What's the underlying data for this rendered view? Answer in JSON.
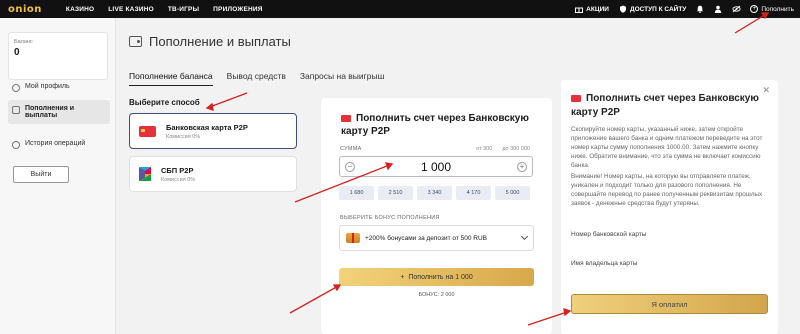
{
  "topbar": {
    "logo": "onion",
    "nav": [
      "КАЗИНО",
      "LIVE КАЗИНО",
      "ТВ-ИГРЫ",
      "ПРИЛОЖЕНИЯ"
    ],
    "promo": "АКЦИИ",
    "access": "ДОСТУП К САЙТУ",
    "deposit": "Пополнить"
  },
  "sidebar": {
    "balance_label": "Баланс",
    "balance_value": "0",
    "items": [
      {
        "label": "Мой профиль"
      },
      {
        "label": "Пополнения и выплаты"
      },
      {
        "label": "История операций"
      }
    ],
    "logout": "Выйти"
  },
  "main": {
    "title": "Пополнение и выплаты",
    "tabs": [
      "Пополнение баланса",
      "Вывод средств",
      "Запросы на выигрыш"
    ],
    "choose_label": "Выберите способ",
    "methods": [
      {
        "title": "Банковская карта P2P",
        "subtitle": "Комиссия 0%"
      },
      {
        "title": "СБП P2P",
        "subtitle": "Комиссия 0%"
      }
    ]
  },
  "payment": {
    "title": "Пополнить счет через Банковскую карту P2P",
    "sum_label": "СУММА",
    "min": "от 300",
    "max": "до 300 000",
    "amount": "1 000",
    "chips": [
      "1 680",
      "2 510",
      "3 340",
      "4 170",
      "5 000"
    ],
    "bonus_label": "ВЫБЕРИТЕ БОНУС ПОПОЛНЕНИЯ",
    "bonus_option": "+200% бонусами за депозит от 500 RUB",
    "pay_button": "Пополнить на 1 000",
    "bonus_total": "БОНУС: 2 000"
  },
  "instructions": {
    "title": "Пополнить счет через Банковскую карту P2P",
    "text1": "Скопируйте номер карты, указанный ниже, затем откройте приложение вашего банка и одним платежом переведите на этот номер карты сумму пополнения 1000.00. Затем нажмите кнопку ниже. Обратите внимание, что эта сумма не включает комиссию банка.",
    "text2": "Внимание! Номер карты, на которую вы отправляете платеж, уникален и подходит только для разового пополнения. Не совершайте перевод по ранее полученным реквизитам прошлых заявок - денежные средства будут утеряны.",
    "card_number_label": "Номер банковской карты",
    "holder_label": "Имя владельца карты",
    "paid_button": "Я оплатил"
  },
  "colors": {
    "accent_gold": "#e0b45a",
    "arrow_red": "#d8201e",
    "selected_border": "#3d4f7a"
  }
}
